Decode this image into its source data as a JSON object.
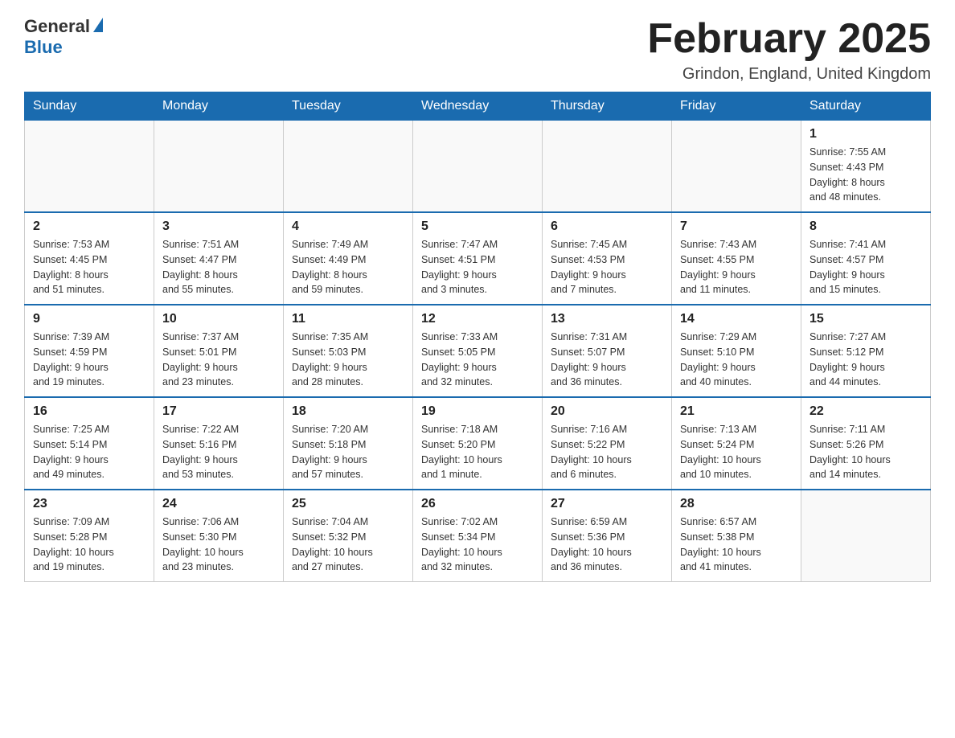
{
  "logo": {
    "general": "General",
    "blue": "Blue"
  },
  "title": "February 2025",
  "location": "Grindon, England, United Kingdom",
  "weekdays": [
    "Sunday",
    "Monday",
    "Tuesday",
    "Wednesday",
    "Thursday",
    "Friday",
    "Saturday"
  ],
  "weeks": [
    [
      {
        "day": "",
        "info": ""
      },
      {
        "day": "",
        "info": ""
      },
      {
        "day": "",
        "info": ""
      },
      {
        "day": "",
        "info": ""
      },
      {
        "day": "",
        "info": ""
      },
      {
        "day": "",
        "info": ""
      },
      {
        "day": "1",
        "info": "Sunrise: 7:55 AM\nSunset: 4:43 PM\nDaylight: 8 hours\nand 48 minutes."
      }
    ],
    [
      {
        "day": "2",
        "info": "Sunrise: 7:53 AM\nSunset: 4:45 PM\nDaylight: 8 hours\nand 51 minutes."
      },
      {
        "day": "3",
        "info": "Sunrise: 7:51 AM\nSunset: 4:47 PM\nDaylight: 8 hours\nand 55 minutes."
      },
      {
        "day": "4",
        "info": "Sunrise: 7:49 AM\nSunset: 4:49 PM\nDaylight: 8 hours\nand 59 minutes."
      },
      {
        "day": "5",
        "info": "Sunrise: 7:47 AM\nSunset: 4:51 PM\nDaylight: 9 hours\nand 3 minutes."
      },
      {
        "day": "6",
        "info": "Sunrise: 7:45 AM\nSunset: 4:53 PM\nDaylight: 9 hours\nand 7 minutes."
      },
      {
        "day": "7",
        "info": "Sunrise: 7:43 AM\nSunset: 4:55 PM\nDaylight: 9 hours\nand 11 minutes."
      },
      {
        "day": "8",
        "info": "Sunrise: 7:41 AM\nSunset: 4:57 PM\nDaylight: 9 hours\nand 15 minutes."
      }
    ],
    [
      {
        "day": "9",
        "info": "Sunrise: 7:39 AM\nSunset: 4:59 PM\nDaylight: 9 hours\nand 19 minutes."
      },
      {
        "day": "10",
        "info": "Sunrise: 7:37 AM\nSunset: 5:01 PM\nDaylight: 9 hours\nand 23 minutes."
      },
      {
        "day": "11",
        "info": "Sunrise: 7:35 AM\nSunset: 5:03 PM\nDaylight: 9 hours\nand 28 minutes."
      },
      {
        "day": "12",
        "info": "Sunrise: 7:33 AM\nSunset: 5:05 PM\nDaylight: 9 hours\nand 32 minutes."
      },
      {
        "day": "13",
        "info": "Sunrise: 7:31 AM\nSunset: 5:07 PM\nDaylight: 9 hours\nand 36 minutes."
      },
      {
        "day": "14",
        "info": "Sunrise: 7:29 AM\nSunset: 5:10 PM\nDaylight: 9 hours\nand 40 minutes."
      },
      {
        "day": "15",
        "info": "Sunrise: 7:27 AM\nSunset: 5:12 PM\nDaylight: 9 hours\nand 44 minutes."
      }
    ],
    [
      {
        "day": "16",
        "info": "Sunrise: 7:25 AM\nSunset: 5:14 PM\nDaylight: 9 hours\nand 49 minutes."
      },
      {
        "day": "17",
        "info": "Sunrise: 7:22 AM\nSunset: 5:16 PM\nDaylight: 9 hours\nand 53 minutes."
      },
      {
        "day": "18",
        "info": "Sunrise: 7:20 AM\nSunset: 5:18 PM\nDaylight: 9 hours\nand 57 minutes."
      },
      {
        "day": "19",
        "info": "Sunrise: 7:18 AM\nSunset: 5:20 PM\nDaylight: 10 hours\nand 1 minute."
      },
      {
        "day": "20",
        "info": "Sunrise: 7:16 AM\nSunset: 5:22 PM\nDaylight: 10 hours\nand 6 minutes."
      },
      {
        "day": "21",
        "info": "Sunrise: 7:13 AM\nSunset: 5:24 PM\nDaylight: 10 hours\nand 10 minutes."
      },
      {
        "day": "22",
        "info": "Sunrise: 7:11 AM\nSunset: 5:26 PM\nDaylight: 10 hours\nand 14 minutes."
      }
    ],
    [
      {
        "day": "23",
        "info": "Sunrise: 7:09 AM\nSunset: 5:28 PM\nDaylight: 10 hours\nand 19 minutes."
      },
      {
        "day": "24",
        "info": "Sunrise: 7:06 AM\nSunset: 5:30 PM\nDaylight: 10 hours\nand 23 minutes."
      },
      {
        "day": "25",
        "info": "Sunrise: 7:04 AM\nSunset: 5:32 PM\nDaylight: 10 hours\nand 27 minutes."
      },
      {
        "day": "26",
        "info": "Sunrise: 7:02 AM\nSunset: 5:34 PM\nDaylight: 10 hours\nand 32 minutes."
      },
      {
        "day": "27",
        "info": "Sunrise: 6:59 AM\nSunset: 5:36 PM\nDaylight: 10 hours\nand 36 minutes."
      },
      {
        "day": "28",
        "info": "Sunrise: 6:57 AM\nSunset: 5:38 PM\nDaylight: 10 hours\nand 41 minutes."
      },
      {
        "day": "",
        "info": ""
      }
    ]
  ]
}
